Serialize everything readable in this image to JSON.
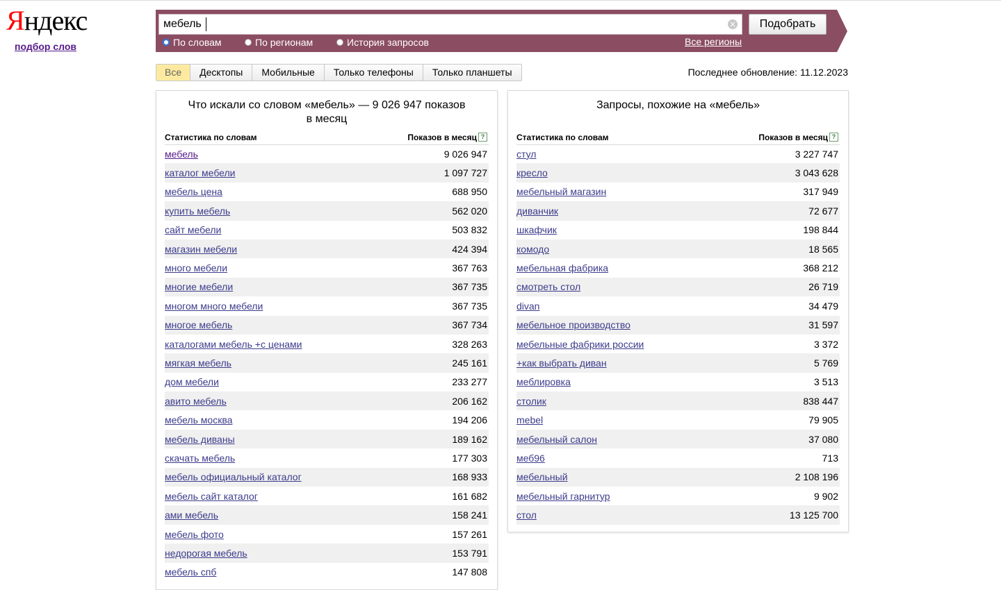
{
  "logo": {
    "first": "Я",
    "rest": "ндекс"
  },
  "sublink": "подбор слов",
  "search": {
    "value": "мебель",
    "clear_glyph": "×",
    "button": "Подобрать",
    "modes": [
      "По словам",
      "По регионам",
      "История запросов"
    ],
    "selected_mode": "По словам",
    "regions_link": "Все регионы"
  },
  "tabs": [
    "Все",
    "Десктопы",
    "Мобильные",
    "Только телефоны",
    "Только планшеты"
  ],
  "active_tab": "Все",
  "last_update": "Последнее обновление: 11.12.2023",
  "left": {
    "title": "Что искали со словом «мебель» — 9 026 947 показов в месяц",
    "col_phrase": "Статистика по словам",
    "col_count": "Показов в месяц",
    "help": "?",
    "rows": [
      {
        "phrase": "мебель",
        "count": "9 026 947"
      },
      {
        "phrase": "каталог мебели",
        "count": "1 097 727"
      },
      {
        "phrase": "мебель цена",
        "count": "688 950"
      },
      {
        "phrase": "купить мебель",
        "count": "562 020"
      },
      {
        "phrase": "сайт мебели",
        "count": "503 832"
      },
      {
        "phrase": "магазин мебели",
        "count": "424 394"
      },
      {
        "phrase": "много мебели",
        "count": "367 763"
      },
      {
        "phrase": "многие мебели",
        "count": "367 735"
      },
      {
        "phrase": "многом много мебели",
        "count": "367 735"
      },
      {
        "phrase": "многое мебель",
        "count": "367 734"
      },
      {
        "phrase": "каталогами мебель +с ценами",
        "count": "328 263"
      },
      {
        "phrase": "мягкая мебель",
        "count": "245 161"
      },
      {
        "phrase": "дом мебели",
        "count": "233 277"
      },
      {
        "phrase": "авито мебель",
        "count": "206 162"
      },
      {
        "phrase": "мебель москва",
        "count": "194 206"
      },
      {
        "phrase": "мебель диваны",
        "count": "189 162"
      },
      {
        "phrase": "скачать мебель",
        "count": "177 303"
      },
      {
        "phrase": "мебель официальный каталог",
        "count": "168 933"
      },
      {
        "phrase": "мебель сайт каталог",
        "count": "161 682"
      },
      {
        "phrase": "ами мебель",
        "count": "158 241"
      },
      {
        "phrase": "мебель фото",
        "count": "157 261"
      },
      {
        "phrase": "недорогая мебель",
        "count": "153 791"
      },
      {
        "phrase": "мебель спб",
        "count": "147 808"
      }
    ]
  },
  "right": {
    "title": "Запросы, похожие на «мебель»",
    "col_phrase": "Статистика по словам",
    "col_count": "Показов в месяц",
    "help": "?",
    "rows": [
      {
        "phrase": "стул",
        "count": "3 227 747"
      },
      {
        "phrase": "кресло",
        "count": "3 043 628"
      },
      {
        "phrase": "мебельный магазин",
        "count": "317 949"
      },
      {
        "phrase": "диванчик",
        "count": "72 677"
      },
      {
        "phrase": "шкафчик",
        "count": "198 844"
      },
      {
        "phrase": "комодо",
        "count": "18 565"
      },
      {
        "phrase": "мебельная фабрика",
        "count": "368 212"
      },
      {
        "phrase": "смотреть стол",
        "count": "26 719"
      },
      {
        "phrase": "divan",
        "count": "34 479"
      },
      {
        "phrase": "мебельное производство",
        "count": "31 597"
      },
      {
        "phrase": "мебельные фабрики россии",
        "count": "3 372"
      },
      {
        "phrase": "+как выбрать диван",
        "count": "5 769"
      },
      {
        "phrase": "меблировка",
        "count": "3 513"
      },
      {
        "phrase": "столик",
        "count": "838 447"
      },
      {
        "phrase": "mebel",
        "count": "79 905"
      },
      {
        "phrase": "мебельный салон",
        "count": "37 080"
      },
      {
        "phrase": "меб96",
        "count": "713"
      },
      {
        "phrase": "мебельный",
        "count": "2 108 196"
      },
      {
        "phrase": "мебельный гарнитур",
        "count": "9 902"
      },
      {
        "phrase": "стол",
        "count": "13 125 700"
      }
    ]
  },
  "colors": {
    "panel_bg": "#8b4d62",
    "link": "#3c3c8c",
    "visited": "#551a8b",
    "logo_red": "#ff0000",
    "active_tab": "#fdeaa0"
  }
}
